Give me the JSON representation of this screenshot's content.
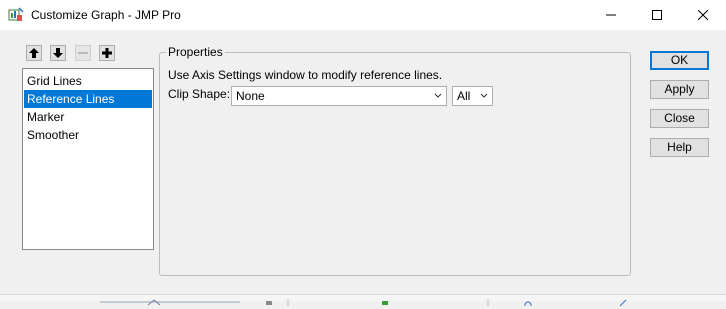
{
  "window": {
    "title": "Customize Graph - JMP Pro",
    "icon": "jmp-app-icon"
  },
  "toolbar": {
    "up_icon": "arrow-up-icon",
    "down_icon": "arrow-down-icon",
    "remove_icon": "minus-icon",
    "add_icon": "plus-icon"
  },
  "list": {
    "items": [
      {
        "label": "Grid Lines",
        "selected": false
      },
      {
        "label": "Reference Lines",
        "selected": true
      },
      {
        "label": "Marker",
        "selected": false
      },
      {
        "label": "Smoother",
        "selected": false
      }
    ]
  },
  "properties": {
    "group_label": "Properties",
    "info": "Use Axis Settings window to modify reference lines.",
    "clip_label": "Clip Shape:",
    "clip_shape_value": "None",
    "scope_value": "All"
  },
  "buttons": {
    "ok": "OK",
    "apply": "Apply",
    "close": "Close",
    "help": "Help"
  },
  "colors": {
    "selection": "#0078d7",
    "default_button_border": "#0078d7"
  }
}
